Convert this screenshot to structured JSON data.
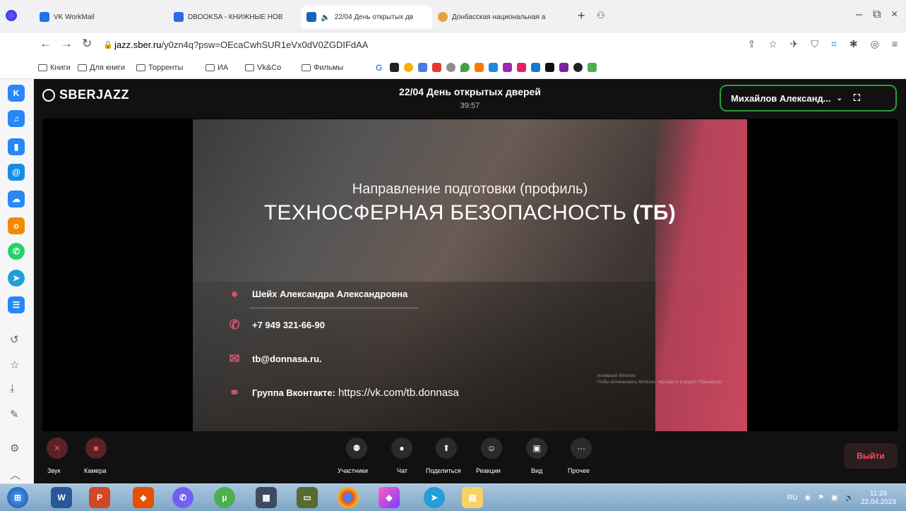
{
  "browser": {
    "tabs": [
      {
        "label": "VK WorkMail",
        "color": "#1a73e8"
      },
      {
        "label": "DBOOKSA - КНИЖНЫЕ НОВ",
        "color": "#2d6ae3"
      },
      {
        "label": "22/04 День открытых дв",
        "color": "#1565c0"
      },
      {
        "label": "Донбасская национальная а",
        "color": "#e6a23c"
      }
    ],
    "new_tab_icon": "+",
    "url_host": "jazz.sber.ru",
    "url_path": "/y0zn4q?psw=OEcaCwhSUR1eVx0dV0ZGDIFdAA",
    "bookmarks": [
      "Книги",
      "Для книги",
      "Торренты",
      "ИА",
      "Vk&Co",
      "Фильмы"
    ]
  },
  "meeting": {
    "brand": "SBERJAZZ",
    "title": "22/04 День открытых дверей",
    "timer": "39:57",
    "user": "Михайлов Александ...",
    "accent": "#21a038"
  },
  "slide": {
    "subtitle": "Направление подготовки (профиль)",
    "heading": "ТЕХНОСФЕРНАЯ БЕЗОПАСНОСТЬ",
    "heading_abbr": "(ТБ)",
    "contact_name": "Шейх Александра Александровна",
    "phone": "+7 949 321-66-90",
    "email": "tb@donnasa.ru.",
    "group_label": "Группа Вконтакте:",
    "group_link": "https://vk.com/tb.donnasa",
    "watermark_title": "Активация Windows",
    "watermark_sub": "Чтобы активировать Windows, перейдите в раздел \"Параметры\"."
  },
  "controls": {
    "sound": "Звук",
    "camera": "Камера",
    "participants": "Участники",
    "chat": "Чат",
    "share": "Поделиться",
    "reactions": "Реакции",
    "view": "Вид",
    "more": "Прочее",
    "exit": "Выйти"
  },
  "taskbar": {
    "lang": "RU",
    "time": "11:29",
    "date": "22.04.2023"
  }
}
